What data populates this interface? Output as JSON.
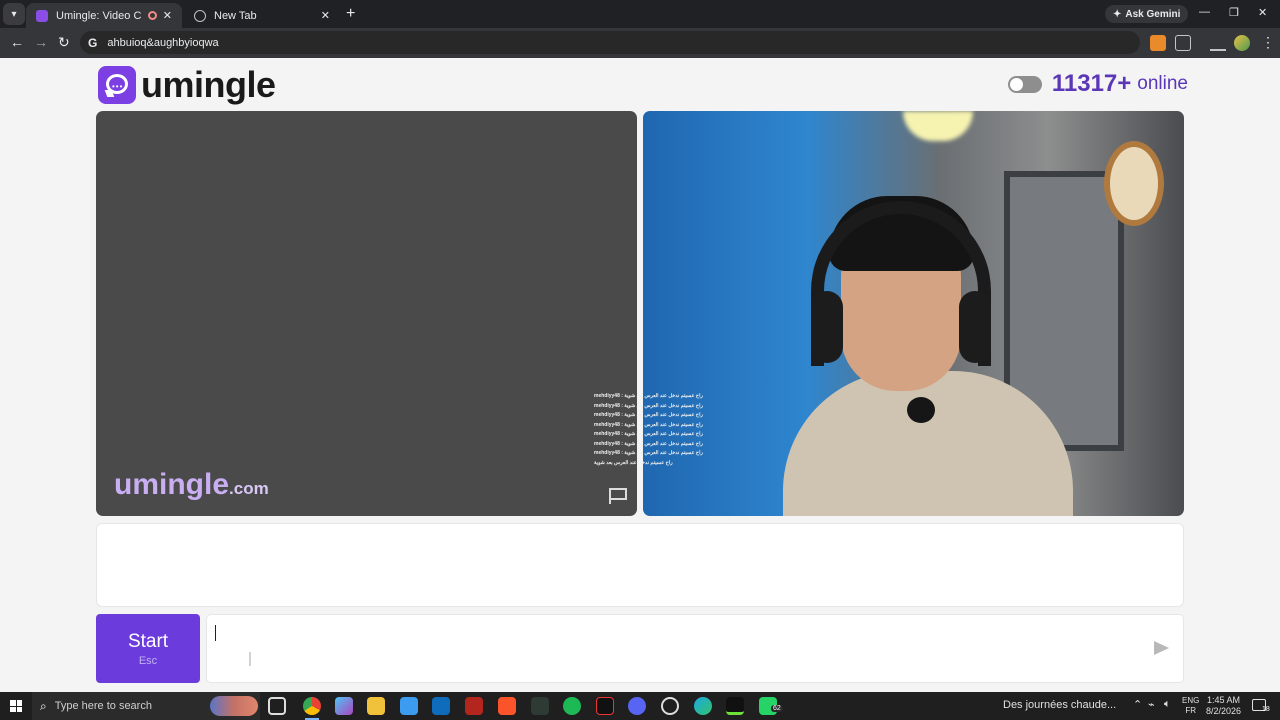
{
  "browser": {
    "tabs": [
      {
        "title": "Umingle: Video Chat with S",
        "active": true
      },
      {
        "title": "New Tab",
        "active": false
      }
    ],
    "new_tab_label": "+",
    "ask_gemini": "Ask Gemini",
    "address": "ahbuioq&aughbyioqwa",
    "window_controls": {
      "minimize": "—",
      "restore": "❐",
      "close": "✕"
    }
  },
  "page": {
    "brand": "umingle",
    "online_count": "11317+",
    "online_label": "online",
    "watermark": {
      "name": "umingle",
      "domain": ".com"
    },
    "overlay_lines": [
      "mehdiyy48 : راح عسيتم ندخل عند العرس بعد شوية",
      "mehdiyy48 : راح عسيتم ندخل عند العرس بعد شوية",
      "mehdiyy48 : راح عسيتم ندخل عند العرس بعد شوية",
      "mehdiyy48 : راح عسيتم ندخل عند العرس بعد شوية",
      "mehdiyy48 : راح عسيتم ندخل عند العرس بعد شوية",
      "mehdiyy48 : راح عسيتم ندخل عند العرس بعد شوية",
      "mehdiyy48 : راح عسيتم ندخل عند العرس بعد شوية",
      "راح عسيتم ندخل عند العرس بعد شوية"
    ],
    "start_label": "Start",
    "start_shortcut": "Esc",
    "message_value": ""
  },
  "taskbar": {
    "search_placeholder": "Type here to search",
    "news": "Des journées chaude...",
    "apps_badge": "62",
    "language": [
      "ENG",
      "FR"
    ],
    "time": "1:45 AM",
    "date": "8/2/2026",
    "notifications": "18"
  },
  "colors": {
    "accent": "#6c3bdb",
    "online": "#5b37b7",
    "watermark": "#c9aef2"
  }
}
